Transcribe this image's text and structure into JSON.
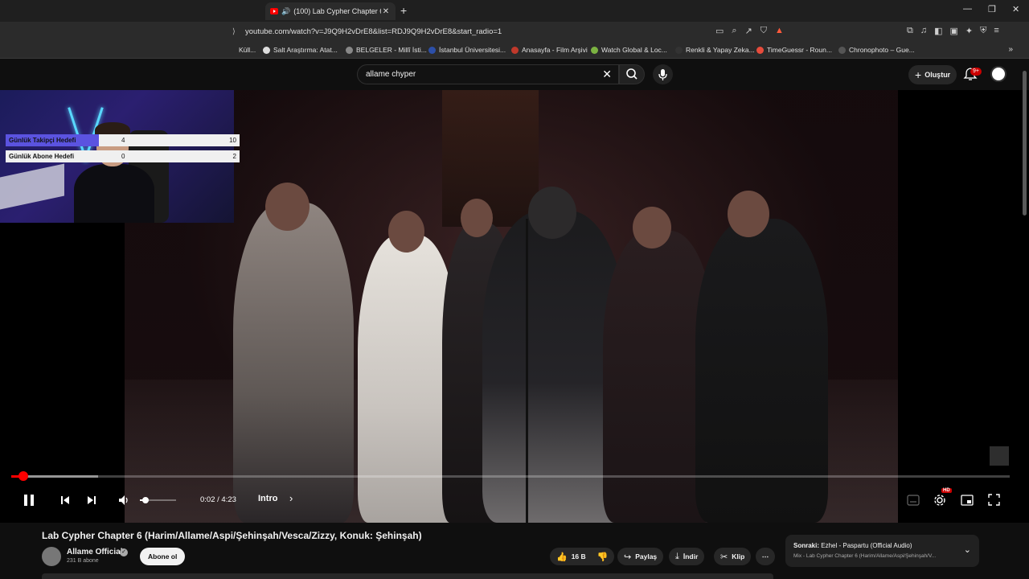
{
  "browser": {
    "tab_title": "(100) Lab Cypher Chapter 6 (",
    "tab_close": "✕",
    "new_tab": "+",
    "url_prefix": "⟩",
    "url": "youtube.com/watch?v=J9Q9H2vDrE8&list=RDJ9Q9H2vDrE8&start_radio=1",
    "window_minimize": "—",
    "window_restore": "❐",
    "window_close": "✕",
    "bookmarks": [
      {
        "label": "Küll...",
        "color": "#555555"
      },
      {
        "label": "Salt Araştırma: Atat...",
        "color": "#dddddd"
      },
      {
        "label": "BELGELER - Millî İsti...",
        "color": "#888888"
      },
      {
        "label": "İstanbul Üniversitesi...",
        "color": "#2c4fa8"
      },
      {
        "label": "Anasayfa - Film Arşivi",
        "color": "#c0392b"
      },
      {
        "label": "Watch Global & Loc...",
        "color": "#7cb342"
      },
      {
        "label": "Renkli & Yapay Zeka...",
        "color": "#333333"
      },
      {
        "label": "TimeGuessr - Roun...",
        "color": "#e74c3c"
      },
      {
        "label": "Chronophoto – Gue...",
        "color": "#555555"
      }
    ],
    "bookmarks_more": "»"
  },
  "youtube": {
    "search_value": "allame chyper",
    "create_label": "Oluştur",
    "notification_count": "9+"
  },
  "overlay": {
    "goals": [
      {
        "label": "Günlük Takipçi Hedefi",
        "current": "4",
        "target": "10",
        "progress": 0.4
      },
      {
        "label": "Günlük Abone Hedefi",
        "current": "0",
        "target": "2",
        "progress": 0
      }
    ]
  },
  "player": {
    "current_time": "0:02",
    "duration": "4:23",
    "time_display": "0:02 / 4:23",
    "chapter": "Intro",
    "hd_badge": "HD",
    "progress": 0.008,
    "buffered": 0.087,
    "volume": 0.15
  },
  "video": {
    "title": "Lab Cypher Chapter 6 (Harim/Allame/Aspi/Şehinşah/Vesca/Zizzy, Konuk: Şehinşah)",
    "channel": "Allame Official",
    "verified_mark": "✓",
    "subscribers": "231 B abone",
    "subscribe_label": "Abone ol",
    "likes": "16 B",
    "share_label": "Paylaş",
    "download_label": "İndir",
    "clip_label": "Klip",
    "more_label": "⋯"
  },
  "up_next": {
    "prefix": "Sonraki:",
    "title": "Ezhel - Paspartu (Official Audio)",
    "subtitle": "Mix - Lab Cypher Chapter 6 (Harim/Allame/Aspi/Şehinşah/V..."
  }
}
